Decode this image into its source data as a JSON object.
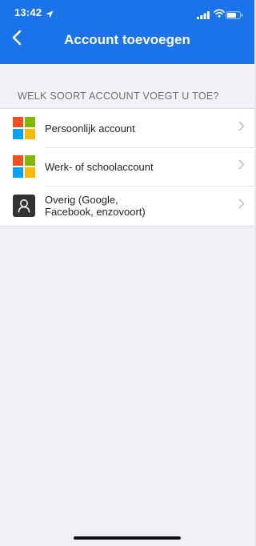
{
  "status_bar": {
    "time": "13:42",
    "location_icon": "location-arrow-icon",
    "signal_icon": "cell-signal-icon",
    "wifi_icon": "wifi-icon",
    "battery_icon": "battery-icon"
  },
  "nav": {
    "title": "Account toevoegen",
    "back_icon": "chevron-left-icon"
  },
  "section": {
    "header": "WELK SOORT ACCOUNT VOEGT U TOE?"
  },
  "accounts": [
    {
      "label": "Persoonlijk account",
      "icon": "microsoft-logo-icon"
    },
    {
      "label": "Werk- of schoolaccount",
      "icon": "microsoft-logo-icon"
    },
    {
      "label_line1": "Overig (Google,",
      "label_line2": "Facebook, enzovoort)",
      "icon": "person-icon"
    }
  ],
  "colors": {
    "header_bg": "#1a73e8",
    "ms_red": "#f25022",
    "ms_green": "#7fba00",
    "ms_blue": "#00a4ef",
    "ms_yellow": "#ffb900"
  }
}
